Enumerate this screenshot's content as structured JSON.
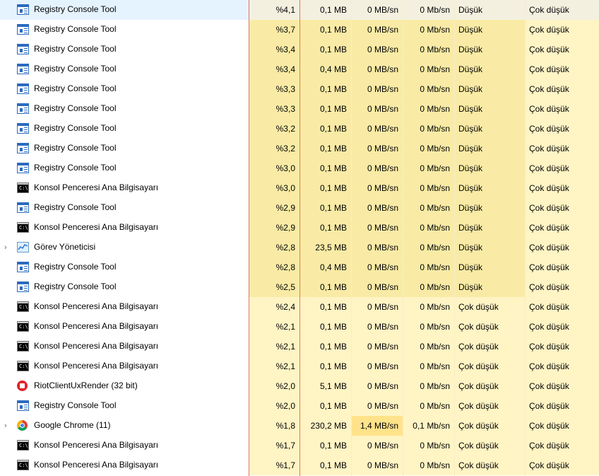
{
  "rows": [
    {
      "name": "Registry Console Tool",
      "icon": "registry-app-icon",
      "expandable": false,
      "cpu": "%4,1",
      "mem": "0,1 MB",
      "disk": "0 MB/sn",
      "net": "0 Mb/sn",
      "power": "Düşük",
      "trend": "Çok düşük",
      "selected": true
    },
    {
      "name": "Registry Console Tool",
      "icon": "registry-app-icon",
      "expandable": false,
      "cpu": "%3,7",
      "mem": "0,1 MB",
      "disk": "0 MB/sn",
      "net": "0 Mb/sn",
      "power": "Düşük",
      "trend": "Çok düşük"
    },
    {
      "name": "Registry Console Tool",
      "icon": "registry-app-icon",
      "expandable": false,
      "cpu": "%3,4",
      "mem": "0,1 MB",
      "disk": "0 MB/sn",
      "net": "0 Mb/sn",
      "power": "Düşük",
      "trend": "Çok düşük"
    },
    {
      "name": "Registry Console Tool",
      "icon": "registry-app-icon",
      "expandable": false,
      "cpu": "%3,4",
      "mem": "0,4 MB",
      "disk": "0 MB/sn",
      "net": "0 Mb/sn",
      "power": "Düşük",
      "trend": "Çok düşük"
    },
    {
      "name": "Registry Console Tool",
      "icon": "registry-app-icon",
      "expandable": false,
      "cpu": "%3,3",
      "mem": "0,1 MB",
      "disk": "0 MB/sn",
      "net": "0 Mb/sn",
      "power": "Düşük",
      "trend": "Çok düşük"
    },
    {
      "name": "Registry Console Tool",
      "icon": "registry-app-icon",
      "expandable": false,
      "cpu": "%3,3",
      "mem": "0,1 MB",
      "disk": "0 MB/sn",
      "net": "0 Mb/sn",
      "power": "Düşük",
      "trend": "Çok düşük"
    },
    {
      "name": "Registry Console Tool",
      "icon": "registry-app-icon",
      "expandable": false,
      "cpu": "%3,2",
      "mem": "0,1 MB",
      "disk": "0 MB/sn",
      "net": "0 Mb/sn",
      "power": "Düşük",
      "trend": "Çok düşük"
    },
    {
      "name": "Registry Console Tool",
      "icon": "registry-app-icon",
      "expandable": false,
      "cpu": "%3,2",
      "mem": "0,1 MB",
      "disk": "0 MB/sn",
      "net": "0 Mb/sn",
      "power": "Düşük",
      "trend": "Çok düşük"
    },
    {
      "name": "Registry Console Tool",
      "icon": "registry-app-icon",
      "expandable": false,
      "cpu": "%3,0",
      "mem": "0,1 MB",
      "disk": "0 MB/sn",
      "net": "0 Mb/sn",
      "power": "Düşük",
      "trend": "Çok düşük"
    },
    {
      "name": "Konsol Penceresi Ana Bilgisayarı",
      "icon": "console-window-icon",
      "expandable": false,
      "cpu": "%3,0",
      "mem": "0,1 MB",
      "disk": "0 MB/sn",
      "net": "0 Mb/sn",
      "power": "Düşük",
      "trend": "Çok düşük"
    },
    {
      "name": "Registry Console Tool",
      "icon": "registry-app-icon",
      "expandable": false,
      "cpu": "%2,9",
      "mem": "0,1 MB",
      "disk": "0 MB/sn",
      "net": "0 Mb/sn",
      "power": "Düşük",
      "trend": "Çok düşük"
    },
    {
      "name": "Konsol Penceresi Ana Bilgisayarı",
      "icon": "console-window-icon",
      "expandable": false,
      "cpu": "%2,9",
      "mem": "0,1 MB",
      "disk": "0 MB/sn",
      "net": "0 Mb/sn",
      "power": "Düşük",
      "trend": "Çok düşük"
    },
    {
      "name": "Görev Yöneticisi",
      "icon": "task-manager-icon",
      "expandable": true,
      "cpu": "%2,8",
      "mem": "23,5 MB",
      "disk": "0 MB/sn",
      "net": "0 Mb/sn",
      "power": "Düşük",
      "trend": "Çok düşük"
    },
    {
      "name": "Registry Console Tool",
      "icon": "registry-app-icon",
      "expandable": false,
      "cpu": "%2,8",
      "mem": "0,4 MB",
      "disk": "0 MB/sn",
      "net": "0 Mb/sn",
      "power": "Düşük",
      "trend": "Çok düşük"
    },
    {
      "name": "Registry Console Tool",
      "icon": "registry-app-icon",
      "expandable": false,
      "cpu": "%2,5",
      "mem": "0,1 MB",
      "disk": "0 MB/sn",
      "net": "0 Mb/sn",
      "power": "Düşük",
      "trend": "Çok düşük"
    },
    {
      "name": "Konsol Penceresi Ana Bilgisayarı",
      "icon": "console-window-icon",
      "expandable": false,
      "cpu": "%2,4",
      "mem": "0,1 MB",
      "disk": "0 MB/sn",
      "net": "0 Mb/sn",
      "power": "Çok düşük",
      "trend": "Çok düşük"
    },
    {
      "name": "Konsol Penceresi Ana Bilgisayarı",
      "icon": "console-window-icon",
      "expandable": false,
      "cpu": "%2,1",
      "mem": "0,1 MB",
      "disk": "0 MB/sn",
      "net": "0 Mb/sn",
      "power": "Çok düşük",
      "trend": "Çok düşük"
    },
    {
      "name": "Konsol Penceresi Ana Bilgisayarı",
      "icon": "console-window-icon",
      "expandable": false,
      "cpu": "%2,1",
      "mem": "0,1 MB",
      "disk": "0 MB/sn",
      "net": "0 Mb/sn",
      "power": "Çok düşük",
      "trend": "Çok düşük"
    },
    {
      "name": "Konsol Penceresi Ana Bilgisayarı",
      "icon": "console-window-icon",
      "expandable": false,
      "cpu": "%2,1",
      "mem": "0,1 MB",
      "disk": "0 MB/sn",
      "net": "0 Mb/sn",
      "power": "Çok düşük",
      "trend": "Çok düşük"
    },
    {
      "name": "RiotClientUxRender (32 bit)",
      "icon": "riot-client-icon",
      "expandable": false,
      "cpu": "%2,0",
      "mem": "5,1 MB",
      "disk": "0 MB/sn",
      "net": "0 Mb/sn",
      "power": "Çok düşük",
      "trend": "Çok düşük"
    },
    {
      "name": "Registry Console Tool",
      "icon": "registry-app-icon",
      "expandable": false,
      "cpu": "%2,0",
      "mem": "0,1 MB",
      "disk": "0 MB/sn",
      "net": "0 Mb/sn",
      "power": "Çok düşük",
      "trend": "Çok düşük"
    },
    {
      "name": "Google Chrome (11)",
      "icon": "chrome-icon",
      "expandable": true,
      "cpu": "%1,8",
      "mem": "230,2 MB",
      "disk": "1,4 MB/sn",
      "net": "0,1 Mb/sn",
      "power": "Çok düşük",
      "trend": "Çok düşük",
      "disk_highlight": true
    },
    {
      "name": "Konsol Penceresi Ana Bilgisayarı",
      "icon": "console-window-icon",
      "expandable": false,
      "cpu": "%1,7",
      "mem": "0,1 MB",
      "disk": "0 MB/sn",
      "net": "0 Mb/sn",
      "power": "Çok düşük",
      "trend": "Çok düşük"
    },
    {
      "name": "Konsol Penceresi Ana Bilgisayarı",
      "icon": "console-window-icon",
      "expandable": false,
      "cpu": "%1,7",
      "mem": "0,1 MB",
      "disk": "0 MB/sn",
      "net": "0 Mb/sn",
      "power": "Çok düşük",
      "trend": "Çok düşük"
    }
  ],
  "console_glyph": "C:\\",
  "expander_glyph": "›",
  "colors": {
    "cell_low": "#f9eba5",
    "cell_verylow": "#fff4c4",
    "cell_highlight": "#ffe38a",
    "sort_line": "#e07a4f",
    "selection": "#e5f3ff"
  }
}
